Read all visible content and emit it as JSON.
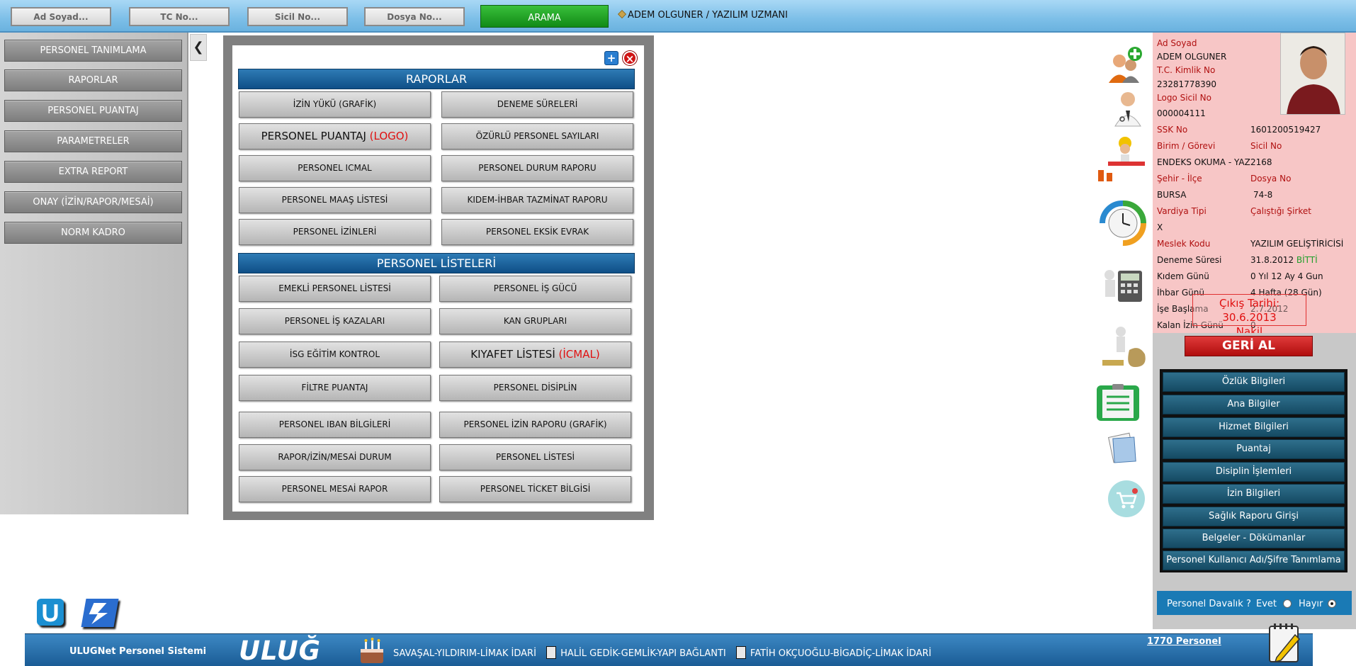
{
  "search": {
    "name_placeholder": "Ad Soyad...",
    "tc_placeholder": "TC No...",
    "sicil_placeholder": "Sicil No...",
    "dosya_placeholder": "Dosya No...",
    "button_label": "ARAMA"
  },
  "header": {
    "user": "ADEM OLGUNER / YAZILIM UZMANI"
  },
  "leftnav": {
    "items": [
      {
        "label": "PERSONEL TANIMLAMA"
      },
      {
        "label": "RAPORLAR"
      },
      {
        "label": "PERSONEL PUANTAJ"
      },
      {
        "label": "PARAMETRELER"
      },
      {
        "label": "EXTRA REPORT"
      },
      {
        "label": "ONAY (İZİN/RAPOR/MESAİ)"
      },
      {
        "label": "NORM KADRO"
      }
    ],
    "collapse_glyph": "❮"
  },
  "reports": {
    "add_glyph": "+",
    "close_glyph": "×",
    "section1_title": "RAPORLAR",
    "section1": [
      {
        "label": "İZİN YÜKÜ (GRAFİK)"
      },
      {
        "label": "DENEME SÜRELERİ"
      },
      {
        "label": "PERSONEL PUANTAJ ",
        "red": "(LOGO)"
      },
      {
        "label": "ÖZÜRLÜ PERSONEL SAYILARI"
      },
      {
        "label": "PERSONEL ICMAL"
      },
      {
        "label": "PERSONEL DURUM RAPORU"
      },
      {
        "label": "PERSONEL MAAŞ LİSTESİ"
      },
      {
        "label": "KIDEM-İHBAR TAZMİNAT RAPORU"
      },
      {
        "label": "PERSONEL İZİNLERİ"
      },
      {
        "label": "PERSONEL EKSİK EVRAK"
      }
    ],
    "section2_title": "PERSONEL LİSTELERİ",
    "section2": [
      {
        "label": "EMEKLİ PERSONEL LİSTESİ"
      },
      {
        "label": "PERSONEL İŞ GÜCÜ"
      },
      {
        "label": "PERSONEL İŞ KAZALARI"
      },
      {
        "label": "KAN GRUPLARI"
      },
      {
        "label": "İSG EĞİTİM KONTROL"
      },
      {
        "label": "KIYAFET LİSTESİ ",
        "red": "(İCMAL)"
      },
      {
        "label": "FİLTRE PUANTAJ"
      },
      {
        "label": "PERSONEL DİSİPLİN"
      },
      {
        "label": "PERSONEL IBAN BİLGİLERİ"
      },
      {
        "label": "PERSONEL İZİN RAPORU (GRAFİK)"
      },
      {
        "label": "RAPOR/İZİN/MESAİ DURUM"
      },
      {
        "label": "PERSONEL LİSTESİ"
      },
      {
        "label": "PERSONEL MESAİ RAPOR"
      },
      {
        "label": "PERSONEL TİCKET BİLGİSİ"
      }
    ]
  },
  "profile": {
    "ad_soyad_label": "Ad Soyad",
    "ad_soyad": "ADEM OLGUNER",
    "tc_label": "T.C. Kimlik No",
    "tc": "23281778390",
    "logo_sicil_label": "Logo Sicil No",
    "logo_sicil": "000004111",
    "ssk_label": "SSK No",
    "ssk": "1601200519427",
    "birim_label": "Birim / Görevi",
    "sicil_label": "Sicil No",
    "birim": "ENDEKS OKUMA - YAZ",
    "sicil": "2168",
    "sehir_label": "Şehir - İlçe",
    "dosya_label": "Dosya No",
    "sehir": "BURSA",
    "dosya": "74-8",
    "vardiya_label": "Vardiya Tipi",
    "sirket_label": "Çalıştığı Şirket",
    "vardiya": "X",
    "meslek_label": "Meslek Kodu",
    "meslek": "YAZILIM GELİŞTİRİCİSİ",
    "deneme_label": "Deneme Süresi",
    "deneme": "31.8.2012",
    "deneme_status": "BİTTİ",
    "kidem_label": "Kıdem Günü",
    "kidem": "0 Yıl 12 Ay 4 Gun",
    "ihbar_label": "İhbar Günü",
    "ihbar": "4 Hafta (28 Gün)",
    "ise_label": "İşe Başlama",
    "ise": "2.7.2012",
    "kalan_label": "Kalan İzin Günü",
    "kalan": "0",
    "cikis_line1": "Çıkış Tarihi: 30.6.2013",
    "cikis_line2": "Nakil",
    "geri_al": "GERİ AL"
  },
  "menu": {
    "items": [
      {
        "label": "Özlük Bilgileri"
      },
      {
        "label": "Ana Bilgiler"
      },
      {
        "label": "Hizmet Bilgileri"
      },
      {
        "label": "Puantaj"
      },
      {
        "label": "Disiplin İşlemleri"
      },
      {
        "label": "İzin Bilgileri"
      },
      {
        "label": "Sağlık Raporu Girişi"
      },
      {
        "label": "Belgeler - Dökümanlar"
      },
      {
        "label": "Personel Kullanıcı Adı/Şifre Tanımlama"
      }
    ]
  },
  "davalik": {
    "question": "Personel Davalık ?",
    "yes": "Evet",
    "no": "Hayır"
  },
  "footer": {
    "system_name": "ULUGNet Personel Sistemi",
    "brand": "ULUĞ",
    "birthday1": "SAVAŞAL-YILDIRIM-LİMAK İDARİ",
    "birthday2": "HALİL GEDİK-GEMLİK-YAPI BAĞLANTI",
    "birthday3": "FATİH OKÇUOĞLU-BİGADİÇ-LİMAK İDARİ",
    "personnel_count": "1770 Personel"
  },
  "colors": {
    "accent": "#1a7ab5",
    "search_button": "#1a9a1e",
    "danger": "#c81010",
    "profile_bg": "#f7c6c6"
  }
}
